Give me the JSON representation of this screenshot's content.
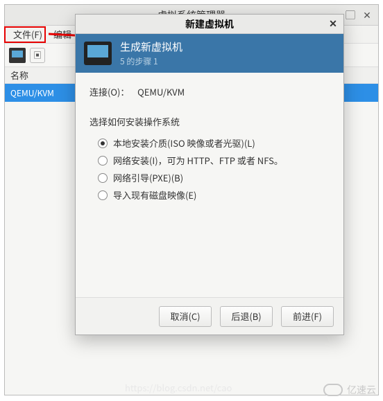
{
  "main_window": {
    "title": "虚拟系统管理器",
    "menu": {
      "file": "文件(F)",
      "edit": "编辑"
    },
    "list_header": "名称",
    "vm_row": "QEMU/KVM"
  },
  "dialog": {
    "title": "新建虚拟机",
    "header_title": "生成新虚拟机",
    "header_step": "5 的步骤 1",
    "connection_label": "连接(O)：",
    "connection_value": "QEMU/KVM",
    "install_prompt": "选择如何安装操作系统",
    "options": {
      "local": "本地安装介质(ISO 映像或者光驱)(L)",
      "network": "网络安装(I)，可为 HTTP、FTP 或者 NFS。",
      "pxe": "网络引导(PXE)(B)",
      "import": "导入现有磁盘映像(E)"
    },
    "buttons": {
      "cancel": "取消(C)",
      "back": "后退(B)",
      "forward": "前进(F)"
    }
  },
  "watermark": {
    "text": "亿速云",
    "csdn": "https://blog.csdn.net/cao"
  }
}
